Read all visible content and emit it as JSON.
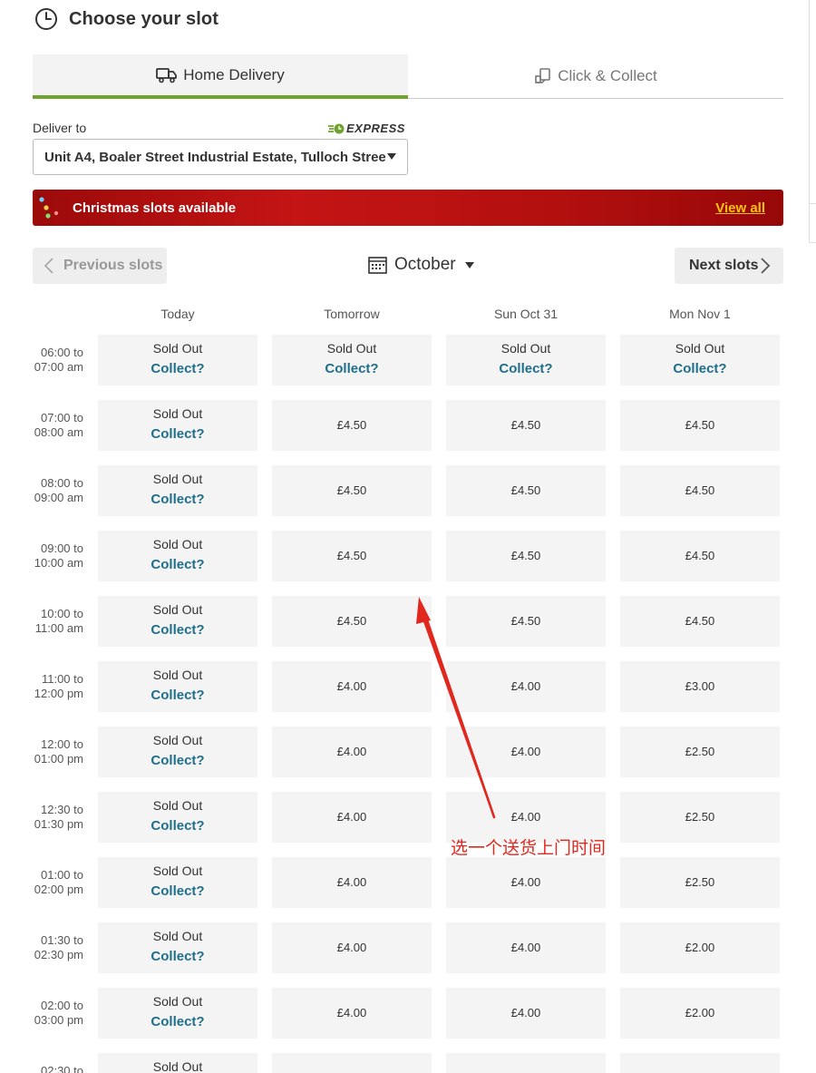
{
  "header": {
    "title": "Choose your slot"
  },
  "tabs": [
    {
      "label": "Home Delivery",
      "active": true
    },
    {
      "label": "Click & Collect",
      "active": false
    }
  ],
  "delivery": {
    "label": "Deliver to",
    "express_badge": "EXPRESS",
    "address": "Unit A4, Boaler Street Industrial Estate, Tulloch Stree"
  },
  "banner": {
    "title": "Christmas slots available",
    "link": "View all"
  },
  "nav": {
    "prev": "Previous slots",
    "next": "Next slots",
    "month": "October"
  },
  "days": [
    "Today",
    "Tomorrow",
    "Sun Oct 31",
    "Mon Nov 1"
  ],
  "texts": {
    "sold_out": "Sold Out",
    "collect": "Collect?"
  },
  "slots": [
    {
      "line1": "06:00 to",
      "line2": "07:00 am",
      "cells": [
        "",
        "",
        "",
        ""
      ]
    },
    {
      "line1": "07:00 to",
      "line2": "08:00 am",
      "cells": [
        "",
        "£4.50",
        "£4.50",
        "£4.50"
      ]
    },
    {
      "line1": "08:00 to",
      "line2": "09:00 am",
      "cells": [
        "",
        "£4.50",
        "£4.50",
        "£4.50"
      ]
    },
    {
      "line1": "09:00 to",
      "line2": "10:00 am",
      "cells": [
        "",
        "£4.50",
        "£4.50",
        "£4.50"
      ]
    },
    {
      "line1": "10:00 to",
      "line2": "11:00 am",
      "cells": [
        "",
        "£4.50",
        "£4.50",
        "£4.50"
      ]
    },
    {
      "line1": "11:00 to",
      "line2": "12:00 pm",
      "cells": [
        "",
        "£4.00",
        "£4.00",
        "£3.00"
      ]
    },
    {
      "line1": "12:00 to",
      "line2": "01:00 pm",
      "cells": [
        "",
        "£4.00",
        "£4.00",
        "£2.50"
      ]
    },
    {
      "line1": "12:30 to",
      "line2": "01:30 pm",
      "cells": [
        "",
        "£4.00",
        "£4.00",
        "£2.50"
      ]
    },
    {
      "line1": "01:00 to",
      "line2": "02:00 pm",
      "cells": [
        "",
        "£4.00",
        "£4.00",
        "£2.50"
      ]
    },
    {
      "line1": "01:30 to",
      "line2": "02:30 pm",
      "cells": [
        "",
        "£4.00",
        "£4.00",
        "£2.00"
      ]
    },
    {
      "line1": "02:00 to",
      "line2": "03:00 pm",
      "cells": [
        "",
        "£4.00",
        "£4.00",
        "£2.00"
      ]
    },
    {
      "line1": "02:30 to",
      "line2": "",
      "cells": [
        "",
        "",
        "",
        ""
      ]
    }
  ],
  "annotation": {
    "text": "选一个送货上门时间",
    "color": "#e0281e"
  },
  "colors": {
    "accent_green": "#6fa22e",
    "collect_blue": "#1f6e8c",
    "banner_red": "#c41414",
    "banner_link": "#ffc20e"
  }
}
